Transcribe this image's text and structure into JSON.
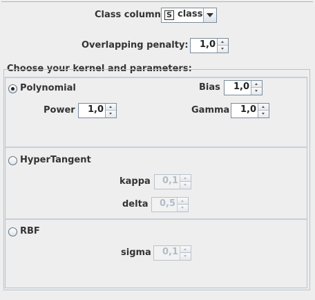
{
  "class_column": {
    "label": "Class column",
    "type_badge": "S",
    "selected": "class"
  },
  "overlapping_penalty": {
    "label": "Overlapping penalty:",
    "value": "1,0"
  },
  "kernel_group": {
    "title": "Choose your kernel and parameters:",
    "polynomial": {
      "label": "Polynomial",
      "selected": true,
      "bias": {
        "label": "Bias",
        "value": "1,0"
      },
      "power": {
        "label": "Power",
        "value": "1,0"
      },
      "gamma": {
        "label": "Gamma",
        "value": "1,0"
      }
    },
    "hypertangent": {
      "label": "HyperTangent",
      "selected": false,
      "kappa": {
        "label": "kappa",
        "value": "0,1"
      },
      "delta": {
        "label": "delta",
        "value": "0,5"
      }
    },
    "rbf": {
      "label": "RBF",
      "selected": false,
      "sigma": {
        "label": "sigma",
        "value": "0,1"
      }
    }
  }
}
